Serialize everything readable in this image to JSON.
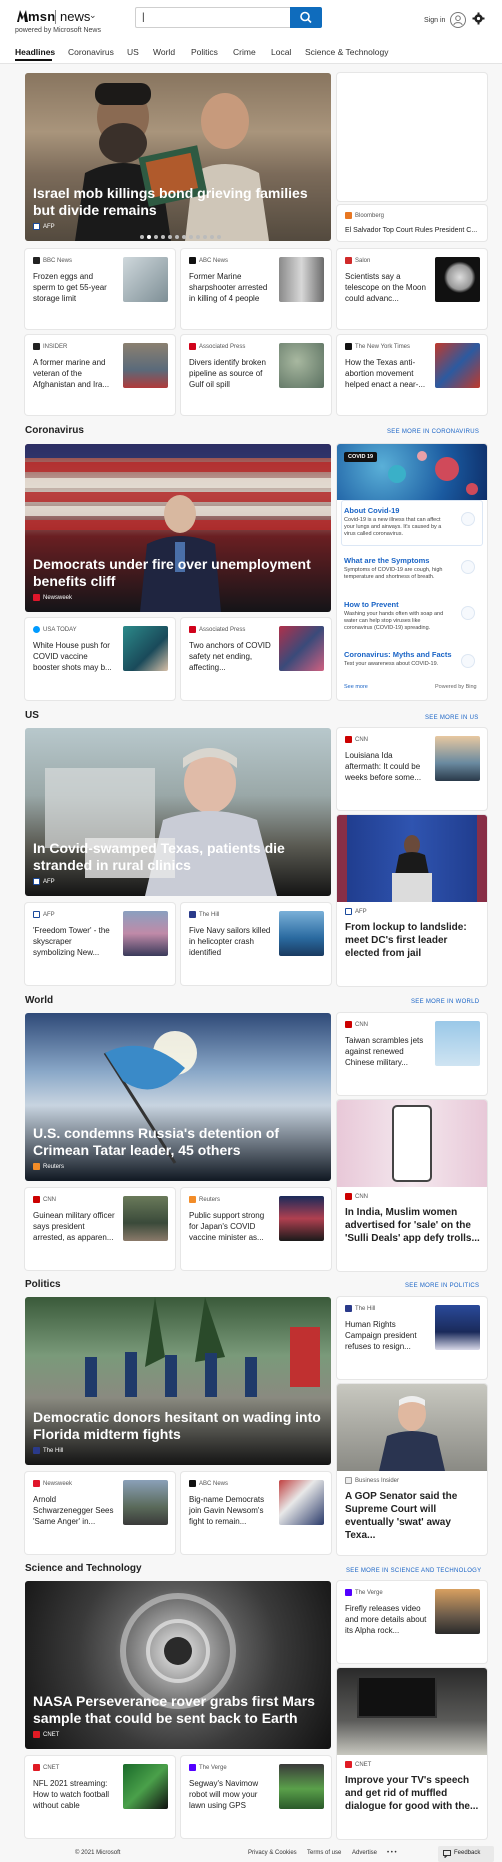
{
  "header": {
    "brand": "msn",
    "section": "news",
    "powered_by": "powered by Microsoft News",
    "search_value": "|",
    "sign_in": "Sign in"
  },
  "nav": [
    "Headlines",
    "Coronavirus",
    "US",
    "World",
    "Politics",
    "Crime",
    "Local",
    "Science & Technology"
  ],
  "headlines": {
    "hero": {
      "title": "Israel mob killings bond grieving families but divide remains",
      "source": "AFP"
    },
    "side_card": {
      "source": "Bloomberg",
      "title": "El Salvador Top Court Rules President C..."
    },
    "row1": [
      {
        "source": "BBC News",
        "title": "Frozen eggs and sperm to get 55-year storage limit"
      },
      {
        "source": "ABC News",
        "title": "Former Marine sharpshooter arrested in killing of 4 people"
      },
      {
        "source": "Salon",
        "title": "Scientists say a telescope on the Moon could advanc..."
      }
    ],
    "row2": [
      {
        "source": "INSIDER",
        "title": "A former marine and veteran of the Afghanistan and Ira..."
      },
      {
        "source": "Associated Press",
        "title": "Divers identify broken pipeline as source of Gulf oil spill"
      },
      {
        "source": "The New York Times",
        "title": "How the Texas anti-abortion movement helped enact a near-..."
      }
    ]
  },
  "coronavirus": {
    "title": "Coronavirus",
    "see_more": "SEE MORE IN CORONAVIRUS",
    "hero": {
      "title": "Democrats under fire over unemployment benefits cliff",
      "source": "Newsweek"
    },
    "cards": [
      {
        "source": "USA TODAY",
        "title": "White House push for COVID vaccine booster shots may b..."
      },
      {
        "source": "Associated Press",
        "title": "Two anchors of COVID safety net ending, affecting..."
      }
    ],
    "panel": {
      "badge": "COVID 19",
      "items": [
        {
          "title": "About Covid-19",
          "desc": "Covid-19 is a new illness that can affect your lungs and airways. It's caused by a virus called coronavirus."
        },
        {
          "title": "What are the Symptoms",
          "desc": "Symptoms of COVID-19 are cough, high temperature and shortness of breath."
        },
        {
          "title": "How to Prevent",
          "desc": "Washing your hands often with soap and water can help stop viruses like coronavirus (COVID-19) spreading."
        },
        {
          "title": "Coronavirus: Myths and Facts",
          "desc": "Test your awareness about COVID-19."
        }
      ],
      "see_more": "See more",
      "powered": "Powered by Bing"
    }
  },
  "us": {
    "title": "US",
    "see_more": "SEE MORE IN US",
    "hero": {
      "title": "In Covid-swamped Texas, patients die stranded in rural clinics",
      "source": "AFP"
    },
    "side_card": {
      "source": "CNN",
      "title": "Louisiana Ida aftermath: It could be weeks before some..."
    },
    "big_card": {
      "source": "AFP",
      "title": "From lockup to landslide: meet DC's first leader elected from jail"
    },
    "cards": [
      {
        "source": "AFP",
        "title": "'Freedom Tower' - the skyscraper symbolizing New..."
      },
      {
        "source": "The Hill",
        "title": "Five Navy sailors killed in helicopter crash identified"
      }
    ]
  },
  "world": {
    "title": "World",
    "see_more": "SEE MORE IN WORLD",
    "hero": {
      "title": "U.S. condemns Russia's detention of Crimean Tatar leader, 45 others",
      "source": "Reuters"
    },
    "side_card": {
      "source": "CNN",
      "title": "Taiwan scrambles jets against renewed Chinese military..."
    },
    "big_card": {
      "source": "CNN",
      "title": "In India, Muslim women advertised for 'sale' on the 'Sulli Deals' app defy trolls..."
    },
    "cards": [
      {
        "source": "CNN",
        "title": "Guinean military officer says president arrested, as apparen..."
      },
      {
        "source": "Reuters",
        "title": "Public support strong for Japan's COVID vaccine minister as..."
      }
    ]
  },
  "politics": {
    "title": "Politics",
    "see_more": "SEE MORE IN POLITICS",
    "hero": {
      "title": "Democratic donors hesitant on wading into Florida midterm fights",
      "source": "The Hill"
    },
    "side_card": {
      "source": "The Hill",
      "title": "Human Rights Campaign president refuses to resign..."
    },
    "big_card": {
      "source": "Business Insider",
      "title": "A GOP Senator said the Supreme Court will eventually 'swat' away Texa..."
    },
    "cards": [
      {
        "source": "Newsweek",
        "title": "Arnold Schwarzenegger Sees 'Same Anger' in..."
      },
      {
        "source": "ABC News",
        "title": "Big-name Democrats join Gavin Newsom's fight to remain..."
      }
    ]
  },
  "scitech": {
    "title": "Science and Technology",
    "see_more": "SEE MORE IN SCIENCE AND TECHNOLOGY",
    "hero": {
      "title": "NASA Perseverance rover grabs first Mars sample that could be sent back to Earth",
      "source": "CNET"
    },
    "side_card": {
      "source": "The Verge",
      "title": "Firefly releases video and more details about its Alpha rock..."
    },
    "big_card": {
      "source": "CNET",
      "title": "Improve your TV's speech and get rid of muffled dialogue for good with the..."
    },
    "cards": [
      {
        "source": "CNET",
        "title": "NFL 2021 streaming: How to watch football without cable"
      },
      {
        "source": "The Verge",
        "title": "Segway's Navimow robot will mow your lawn using GPS"
      }
    ]
  },
  "footer": {
    "copyright": "© 2021 Microsoft",
    "links": [
      "Privacy & Cookies",
      "Terms of use",
      "Advertise"
    ],
    "more": "• • •",
    "feedback": "Feedback"
  }
}
